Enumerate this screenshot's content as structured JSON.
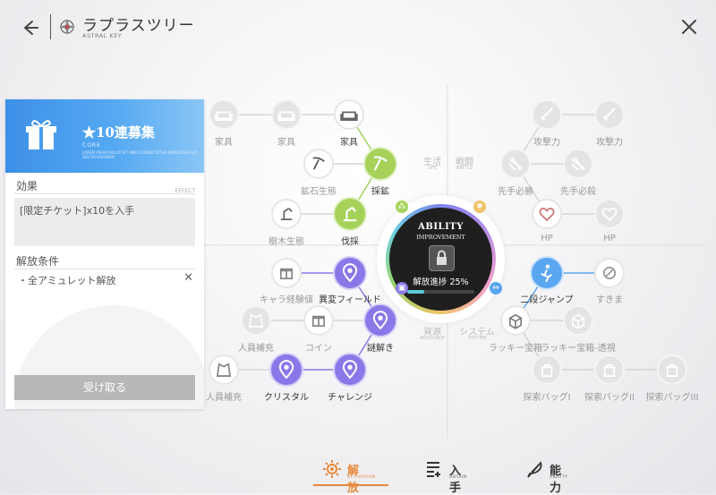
{
  "header": {
    "title": "ラプラスツリー",
    "subtitle": "ASTRAL KEY"
  },
  "panel": {
    "banner_title": "★10連募集",
    "banner_sub": "CORE",
    "banner_desc": "LOREM IPSUM DOLOR SIT AMET CONSECTETUR ADIPISCING ELIT SED DO EIUSMOD",
    "effect_label": "効果",
    "effect_en": "EFFECT",
    "effect_text": "[限定チケット]x10を入手",
    "cond_label": "解放条件",
    "cond_text": "・全アミュレット解放",
    "receive_label": "受け取る"
  },
  "center": {
    "title": "ABILITY",
    "subtitle": "IMPROVEMENT",
    "progress_text": "解放進捗 25%",
    "progress": 0.25
  },
  "categories": {
    "life": "生活",
    "life_en": "LIFE",
    "battle": "戦闘",
    "battle_en": "BATTLE",
    "resource": "資源",
    "resource_en": "RESOURCE",
    "system": "システム",
    "system_en": "SYSTEM"
  },
  "nodes": {
    "furniture1": "家具",
    "furniture2": "家具",
    "furniture3": "家具",
    "ore": "鉱石生態",
    "gather": "採鉱",
    "tree": "樹木生態",
    "lumber": "伐採",
    "atk1": "攻撃力",
    "atk2": "攻撃力",
    "first1": "先手必勝",
    "first2": "先手必殺",
    "hp1": "HP",
    "hp2": "HP",
    "charaexp": "キャラ経験値",
    "anomaly": "異変フィールド",
    "recruit1": "人員補充",
    "coin": "コイン",
    "riddle": "謎解き",
    "recruit2": "人員補充",
    "crystal": "クリスタル",
    "challenge": "チャレンジ",
    "djump": "二段ジャンプ",
    "gap": "すきま",
    "lucky1": "ラッキー宝箱",
    "lucky2": "ラッキー宝箱-透視",
    "bag1": "探索バッグI",
    "bag2": "探索バッグII",
    "bag3": "探索バッグIII"
  },
  "bottom_nav": {
    "release": "解放",
    "release_en": "ACTIVATION",
    "obtain": "入手",
    "obtain_en": "OBTAIN",
    "ability": "能力",
    "ability_en": "ABILITY"
  },
  "colors": {
    "accent_green": "#a6d25a",
    "accent_purple": "#8a78e8",
    "accent_blue": "#5aa6f0",
    "accent_orange": "#e7883a",
    "banner_blue": "#4a9cee"
  }
}
